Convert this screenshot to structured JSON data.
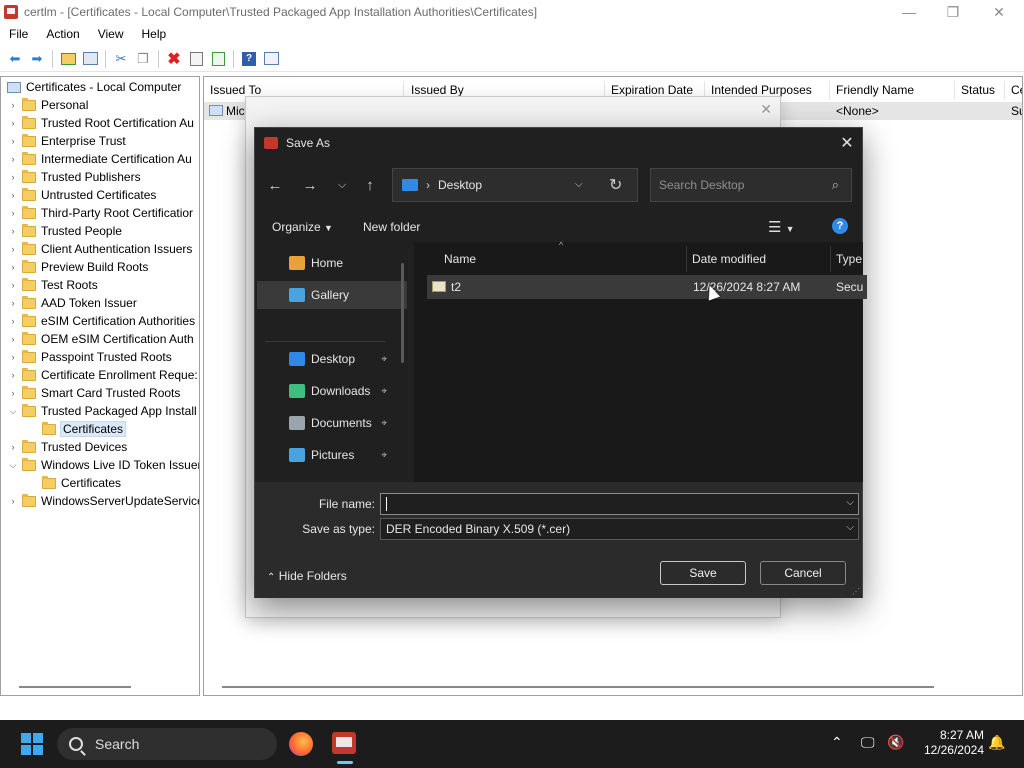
{
  "window": {
    "title": "certlm - [Certificates - Local Computer\\Trusted Packaged App Installation Authorities\\Certificates]",
    "min_glyph": "—",
    "max_glyph": "❐",
    "close_glyph": "✕"
  },
  "menu": [
    "File",
    "Action",
    "View",
    "Help"
  ],
  "tree": {
    "root": "Certificates - Local Computer",
    "items": [
      {
        "label": "Personal",
        "expanded": false
      },
      {
        "label": "Trusted Root Certification Au",
        "expanded": false
      },
      {
        "label": "Enterprise Trust",
        "expanded": false
      },
      {
        "label": "Intermediate Certification Au",
        "expanded": false
      },
      {
        "label": "Trusted Publishers",
        "expanded": false
      },
      {
        "label": "Untrusted Certificates",
        "expanded": false
      },
      {
        "label": "Third-Party Root Certificatior",
        "expanded": false
      },
      {
        "label": "Trusted People",
        "expanded": false
      },
      {
        "label": "Client Authentication Issuers",
        "expanded": false
      },
      {
        "label": "Preview Build Roots",
        "expanded": false
      },
      {
        "label": "Test Roots",
        "expanded": false
      },
      {
        "label": "AAD Token Issuer",
        "expanded": false
      },
      {
        "label": "eSIM Certification Authorities",
        "expanded": false
      },
      {
        "label": "OEM eSIM Certification Auth",
        "expanded": false
      },
      {
        "label": "Passpoint Trusted Roots",
        "expanded": false
      },
      {
        "label": "Certificate Enrollment Reque:",
        "expanded": false
      },
      {
        "label": "Smart Card Trusted Roots",
        "expanded": false
      },
      {
        "label": "Trusted Packaged App Install",
        "expanded": true
      },
      {
        "label": "Certificates",
        "child": true,
        "selected": true
      },
      {
        "label": "Trusted Devices",
        "expanded": false
      },
      {
        "label": "Windows Live ID Token Issuer",
        "expanded": true
      },
      {
        "label": "Certificates",
        "child": true
      },
      {
        "label": "WindowsServerUpdateService",
        "expanded": false
      }
    ]
  },
  "list": {
    "columns": [
      "Issued To",
      "Issued By",
      "Expiration Date",
      "Intended Purposes",
      "Friendly Name",
      "Status",
      "Ce"
    ],
    "row": {
      "issued_to": "Mic",
      "friendly_name": "<None>",
      "status_fragment": "Su"
    }
  },
  "save_as": {
    "title": "Save As",
    "address": "Desktop",
    "search_placeholder": "Search Desktop",
    "organize": "Organize",
    "new_folder": "New folder",
    "nav": [
      {
        "label": "Home",
        "icon": "home-icon",
        "color": "#e8a23a"
      },
      {
        "label": "Gallery",
        "icon": "gallery-icon",
        "color": "#4aa3df",
        "selected": true
      },
      {
        "label": "Desktop",
        "icon": "desktop-icon",
        "color": "#2e8ae6",
        "pinned": true
      },
      {
        "label": "Downloads",
        "icon": "download-icon",
        "color": "#3fbf7f",
        "pinned": true
      },
      {
        "label": "Documents",
        "icon": "document-icon",
        "color": "#9aa4ad",
        "pinned": true
      },
      {
        "label": "Pictures",
        "icon": "pictures-icon",
        "color": "#4aa3df",
        "pinned": true
      }
    ],
    "columns": [
      "Name",
      "Date modified",
      "Type"
    ],
    "files": [
      {
        "name": "t2",
        "date": "12/26/2024 8:27 AM",
        "type": "Secu"
      }
    ],
    "file_name_label": "File name:",
    "file_name_value": "",
    "save_type_label": "Save as type:",
    "save_type_value": "DER Encoded Binary X.509 (*.cer)",
    "hide_folders": "Hide Folders",
    "save": "Save",
    "cancel": "Cancel"
  },
  "taskbar": {
    "search": "Search",
    "time": "8:27 AM",
    "date": "12/26/2024"
  }
}
